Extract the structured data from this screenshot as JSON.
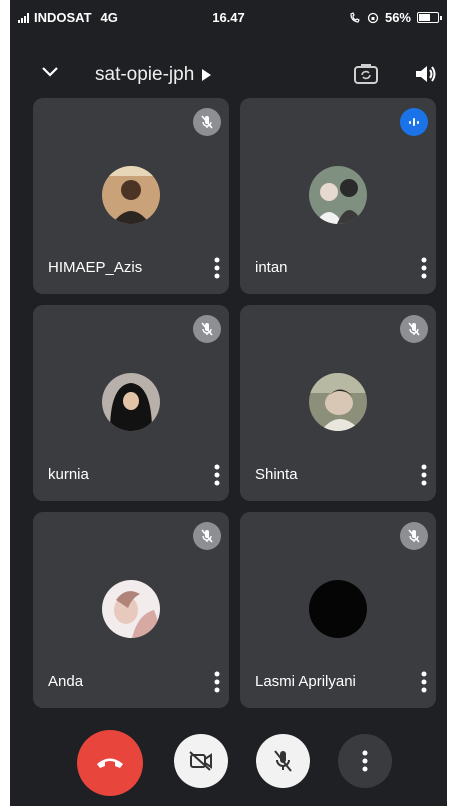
{
  "status_bar": {
    "carrier": "INDOSAT",
    "network": "4G",
    "time": "16.47",
    "battery": "56%",
    "battery_level": 0.56
  },
  "header": {
    "meeting_title": "sat-opie-jph",
    "icons": [
      "chevron-down-icon",
      "play-arrow-icon",
      "switch-camera-icon",
      "speaker-icon"
    ]
  },
  "participants": [
    {
      "name": "HIMAEP_Azis",
      "status": "muted"
    },
    {
      "name": "intan",
      "status": "speaking"
    },
    {
      "name": "kurnia",
      "status": "muted"
    },
    {
      "name": "Shinta",
      "status": "muted"
    },
    {
      "name": "Anda",
      "status": "muted"
    },
    {
      "name": "Lasmi Aprilyani",
      "status": "muted"
    }
  ],
  "controls": {
    "icons": [
      "end-call-icon",
      "camera-off-icon",
      "mic-off-icon",
      "more-options-icon"
    ],
    "end_call_color": "#e8453c"
  },
  "colors": {
    "background": "#1f2023",
    "tile": "#3b3c40",
    "speaking_badge": "#1a73e8",
    "muted_badge": "#8d8f93"
  }
}
